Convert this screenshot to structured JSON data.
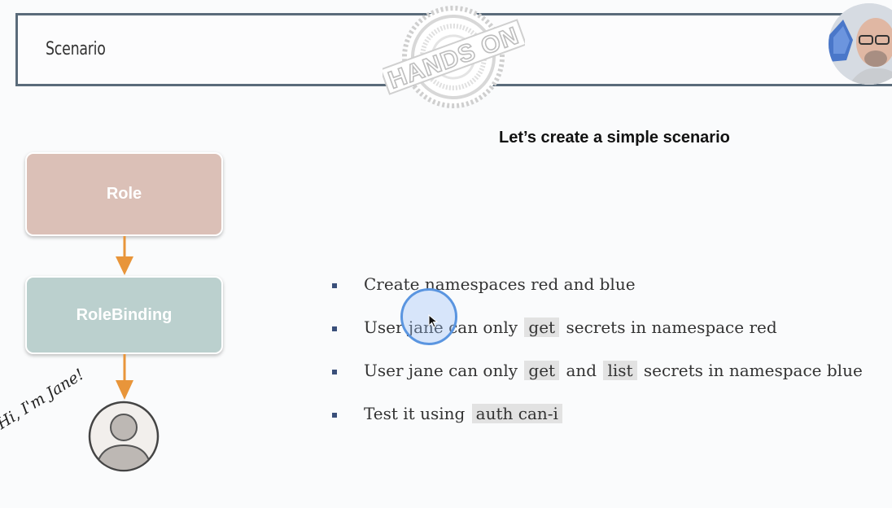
{
  "header": {
    "title": "Scenario",
    "stamp_text": "HANDS ON"
  },
  "slide": {
    "subtitle": "Let’s create a simple scenario",
    "diagram": {
      "role_label": "Role",
      "rolebinding_label": "RoleBinding",
      "speech": "Hi, I'm Jane!",
      "colors": {
        "role": "#dbc0b7",
        "rolebinding": "#bbd0ce",
        "arrow": "#e8953a"
      }
    },
    "bullets": [
      {
        "text": "Create namespaces red and blue"
      },
      {
        "p1": "User jane can only",
        "c1": "get",
        "p2": "secrets in namespace red"
      },
      {
        "p1": "User jane can only",
        "c1": "get",
        "p2": "and",
        "c2": "list",
        "p3": "secrets in namespace blue"
      },
      {
        "p1": "Test it using",
        "c1": "auth can-i"
      }
    ]
  },
  "icons": {
    "presenter": "presenter-webcam",
    "user": "user-avatar-icon",
    "cursor": "mouse-cursor-icon"
  }
}
